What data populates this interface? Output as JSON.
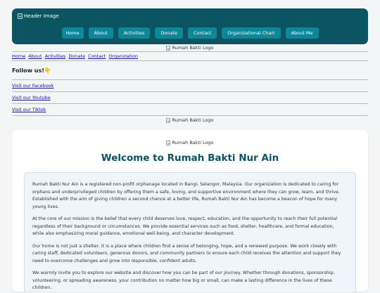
{
  "header": {
    "image_alt": "Header Image",
    "nav": [
      {
        "label": "Home",
        "name": "nav-home"
      },
      {
        "label": "About",
        "name": "nav-about"
      },
      {
        "label": "Activities",
        "name": "nav-activities"
      },
      {
        "label": "Donate",
        "name": "nav-donate"
      },
      {
        "label": "Contact",
        "name": "nav-contact"
      },
      {
        "label": "Organizational Chart",
        "name": "nav-organizational-chart"
      },
      {
        "label": "About Me",
        "name": "nav-about-me"
      }
    ]
  },
  "logo_alt": "Rumah Bakti Logo",
  "text_links": [
    "Home",
    "About",
    "Activities",
    "Donate",
    "Contact",
    "Organization"
  ],
  "follow_heading": "Follow us!👇",
  "social": {
    "facebook": "Visit our Facebook",
    "youtube": "Visit our Youtube",
    "tiktok": "Visit our Tiktok"
  },
  "main": {
    "title": "Welcome to Rumah Bakti Nur Ain",
    "paragraphs": [
      "Rumah Bakti Nur Ain is a registered non-profit orphanage located in Bangi, Selangor, Malaysia. Our organization is dedicated to caring for orphans and underprivileged children by offering them a safe, loving, and supportive environment where they can grow, learn, and thrive. Established with the aim of giving children a second chance at a better life, Rumah Bakti Nur Ain has become a beacon of hope for many young lives.",
      "At the core of our mission is the belief that every child deserves love, respect, education, and the opportunity to reach their full potential regardless of their background or circumstances. We provide essential services such as food, shelter, healthcare, and formal education, while also emphasizing moral guidance, emotional well-being, and character development.",
      "Our home is not just a shelter, it is a place where children find a sense of belonging, hope, and a renewed purpose. We work closely with caring staff, dedicated volunteers, generous donors, and community partners to ensure each child receives the attention and support they need to overcome challenges and grow into responsible, confident adults.",
      "We warmly invite you to explore our website and discover how you can be part of our journey. Whether through donations, sponsorship, volunteering, or spreading awareness, your contribution no matter how big or small, can make a lasting difference in the lives of these children."
    ]
  }
}
